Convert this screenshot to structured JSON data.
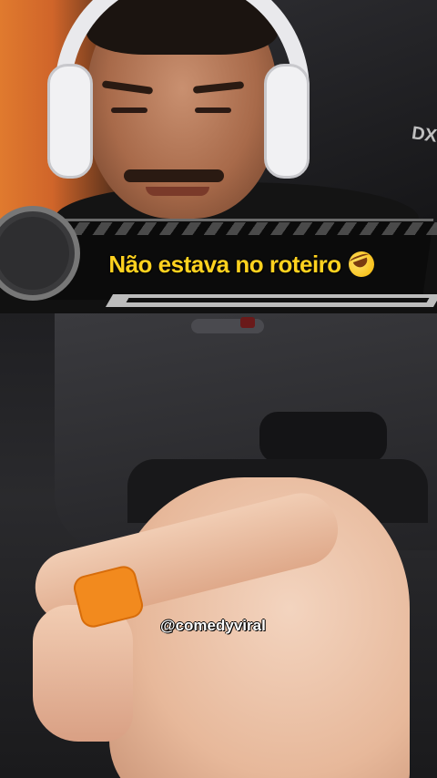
{
  "caption": {
    "text": "Não estava no roteiro",
    "emoji": "rolling-on-floor-laughing-icon",
    "text_color": "#ffd21f"
  },
  "webcam": {
    "chair_logo": "DXR"
  },
  "watermark": {
    "text": "@comedyviral"
  },
  "colors": {
    "banner_background": "#0b0b0b",
    "wristband": "#f28a1e",
    "background_accent": "#e07a2e"
  }
}
